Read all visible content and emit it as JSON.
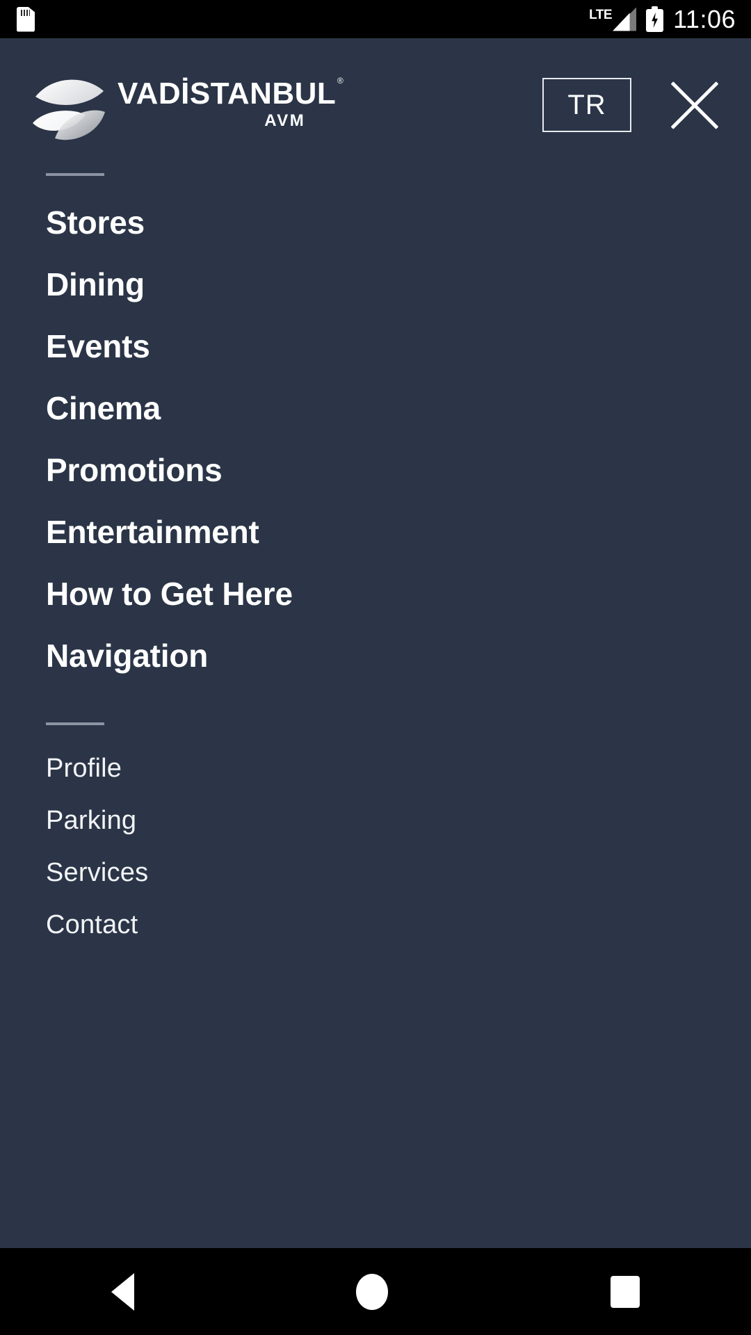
{
  "status_bar": {
    "sd_card_icon": "sd-card-icon",
    "network_label": "LTE",
    "signal_icon": "signal-bars-icon",
    "battery_icon": "battery-charging-icon",
    "time": "11:06"
  },
  "header": {
    "logo_icon": "vadistanbul-leaf-logo",
    "brand_name": "VADİSTANBUL",
    "brand_registered": "®",
    "brand_subtitle": "AVM",
    "language_button": "TR",
    "close_icon": "close-icon"
  },
  "menu": {
    "primary_items": [
      {
        "label": "Stores"
      },
      {
        "label": "Dining"
      },
      {
        "label": "Events"
      },
      {
        "label": "Cinema"
      },
      {
        "label": "Promotions"
      },
      {
        "label": "Entertainment"
      },
      {
        "label": "How to Get Here"
      },
      {
        "label": "Navigation"
      }
    ],
    "secondary_items": [
      {
        "label": "Profile"
      },
      {
        "label": "Parking"
      },
      {
        "label": "Services"
      },
      {
        "label": "Contact"
      }
    ]
  },
  "nav_bar": {
    "back_icon": "back-triangle-icon",
    "home_icon": "home-circle-icon",
    "recents_icon": "recents-square-icon"
  },
  "colors": {
    "background": "#2b3547",
    "text": "#ffffff",
    "divider": "#8c93a3",
    "system_bar": "#000000"
  }
}
